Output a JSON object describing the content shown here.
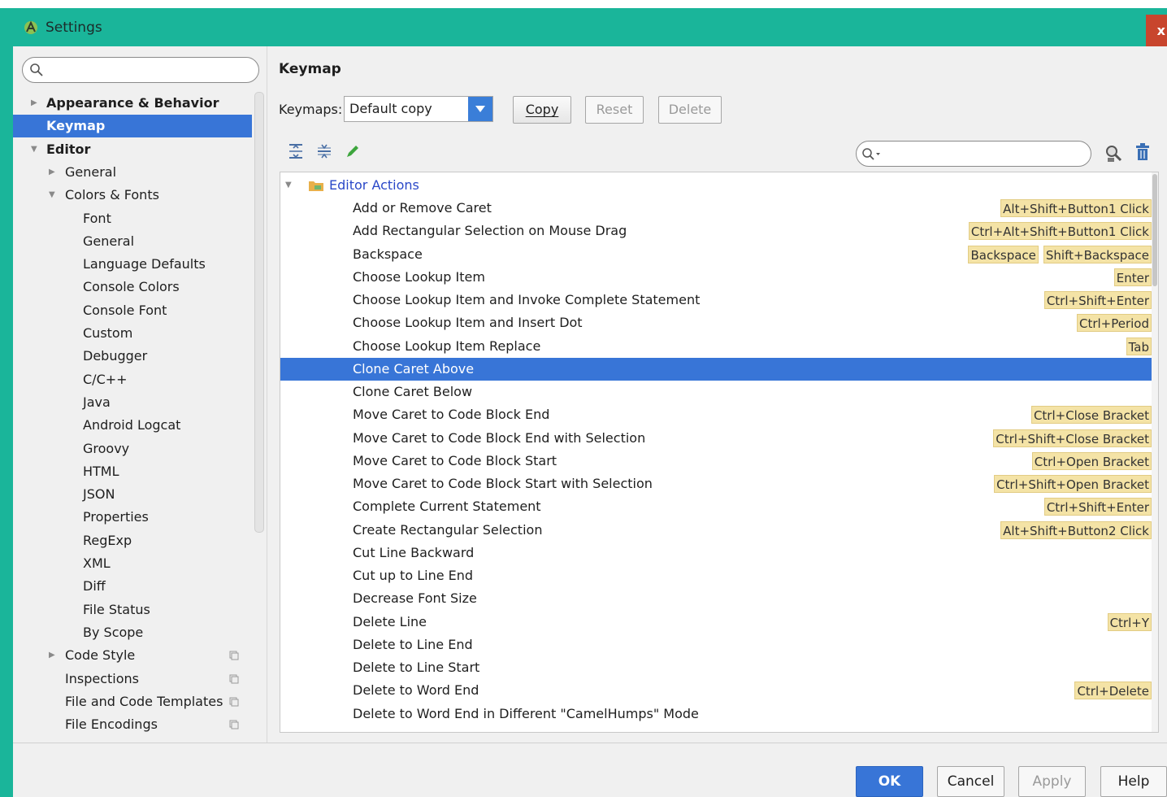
{
  "window": {
    "title": "Settings",
    "close_label": "x"
  },
  "search": {
    "placeholder": ""
  },
  "tree": [
    {
      "label": "Appearance & Behavior",
      "level": 0,
      "arrow": "collapsed",
      "bold": true
    },
    {
      "label": "Keymap",
      "level": 0,
      "arrow": "none",
      "bold": true,
      "selected": true
    },
    {
      "label": "Editor",
      "level": 0,
      "arrow": "expanded",
      "bold": true
    },
    {
      "label": "General",
      "level": 1,
      "arrow": "collapsed"
    },
    {
      "label": "Colors & Fonts",
      "level": 1,
      "arrow": "expanded"
    },
    {
      "label": "Font",
      "level": 2
    },
    {
      "label": "General",
      "level": 2
    },
    {
      "label": "Language Defaults",
      "level": 2
    },
    {
      "label": "Console Colors",
      "level": 2
    },
    {
      "label": "Console Font",
      "level": 2
    },
    {
      "label": "Custom",
      "level": 2
    },
    {
      "label": "Debugger",
      "level": 2
    },
    {
      "label": "C/C++",
      "level": 2
    },
    {
      "label": "Java",
      "level": 2
    },
    {
      "label": "Android Logcat",
      "level": 2
    },
    {
      "label": "Groovy",
      "level": 2
    },
    {
      "label": "HTML",
      "level": 2
    },
    {
      "label": "JSON",
      "level": 2
    },
    {
      "label": "Properties",
      "level": 2
    },
    {
      "label": "RegExp",
      "level": 2
    },
    {
      "label": "XML",
      "level": 2
    },
    {
      "label": "Diff",
      "level": 2
    },
    {
      "label": "File Status",
      "level": 2
    },
    {
      "label": "By Scope",
      "level": 2
    },
    {
      "label": "Code Style",
      "level": 1,
      "arrow": "collapsed",
      "project": true
    },
    {
      "label": "Inspections",
      "level": 1,
      "project": true
    },
    {
      "label": "File and Code Templates",
      "level": 1,
      "project": true
    },
    {
      "label": "File Encodings",
      "level": 1,
      "project": true
    }
  ],
  "keymap": {
    "heading": "Keymap",
    "label": "Keymaps:",
    "selected": "Default copy",
    "copy_label": "Copy",
    "reset_label": "Reset",
    "delete_label": "Delete",
    "filter_placeholder": ""
  },
  "actions": {
    "group": "Editor Actions",
    "rows": [
      {
        "name": "Add or Remove Caret",
        "shortcuts": [
          "Alt+Shift+Button1 Click"
        ]
      },
      {
        "name": "Add Rectangular Selection on Mouse Drag",
        "shortcuts": [
          "Ctrl+Alt+Shift+Button1 Click"
        ]
      },
      {
        "name": "Backspace",
        "shortcuts": [
          "Backspace",
          "Shift+Backspace"
        ]
      },
      {
        "name": "Choose Lookup Item",
        "shortcuts": [
          "Enter"
        ]
      },
      {
        "name": "Choose Lookup Item and Invoke Complete Statement",
        "shortcuts": [
          "Ctrl+Shift+Enter"
        ]
      },
      {
        "name": "Choose Lookup Item and Insert Dot",
        "shortcuts": [
          "Ctrl+Period"
        ]
      },
      {
        "name": "Choose Lookup Item Replace",
        "shortcuts": [
          "Tab"
        ]
      },
      {
        "name": "Clone Caret Above",
        "shortcuts": [],
        "selected": true
      },
      {
        "name": "Clone Caret Below",
        "shortcuts": []
      },
      {
        "name": "Move Caret to Code Block End",
        "shortcuts": [
          "Ctrl+Close Bracket"
        ]
      },
      {
        "name": "Move Caret to Code Block End with Selection",
        "shortcuts": [
          "Ctrl+Shift+Close Bracket"
        ]
      },
      {
        "name": "Move Caret to Code Block Start",
        "shortcuts": [
          "Ctrl+Open Bracket"
        ]
      },
      {
        "name": "Move Caret to Code Block Start with Selection",
        "shortcuts": [
          "Ctrl+Shift+Open Bracket"
        ]
      },
      {
        "name": "Complete Current Statement",
        "shortcuts": [
          "Ctrl+Shift+Enter"
        ]
      },
      {
        "name": "Create Rectangular Selection",
        "shortcuts": [
          "Alt+Shift+Button2 Click"
        ]
      },
      {
        "name": "Cut Line Backward",
        "shortcuts": []
      },
      {
        "name": "Cut up to Line End",
        "shortcuts": []
      },
      {
        "name": "Decrease Font Size",
        "shortcuts": []
      },
      {
        "name": "Delete Line",
        "shortcuts": [
          "Ctrl+Y"
        ]
      },
      {
        "name": "Delete to Line End",
        "shortcuts": []
      },
      {
        "name": "Delete to Line Start",
        "shortcuts": []
      },
      {
        "name": "Delete to Word End",
        "shortcuts": [
          "Ctrl+Delete"
        ]
      },
      {
        "name": "Delete to Word End in Different \"CamelHumps\" Mode",
        "shortcuts": []
      }
    ]
  },
  "footer": {
    "ok": "OK",
    "cancel": "Cancel",
    "apply": "Apply",
    "help": "Help"
  },
  "colors": {
    "accent": "#1ab59a",
    "selection": "#3875d7",
    "shortcut_bg": "#f4e3a6",
    "link": "#2a48c8"
  }
}
